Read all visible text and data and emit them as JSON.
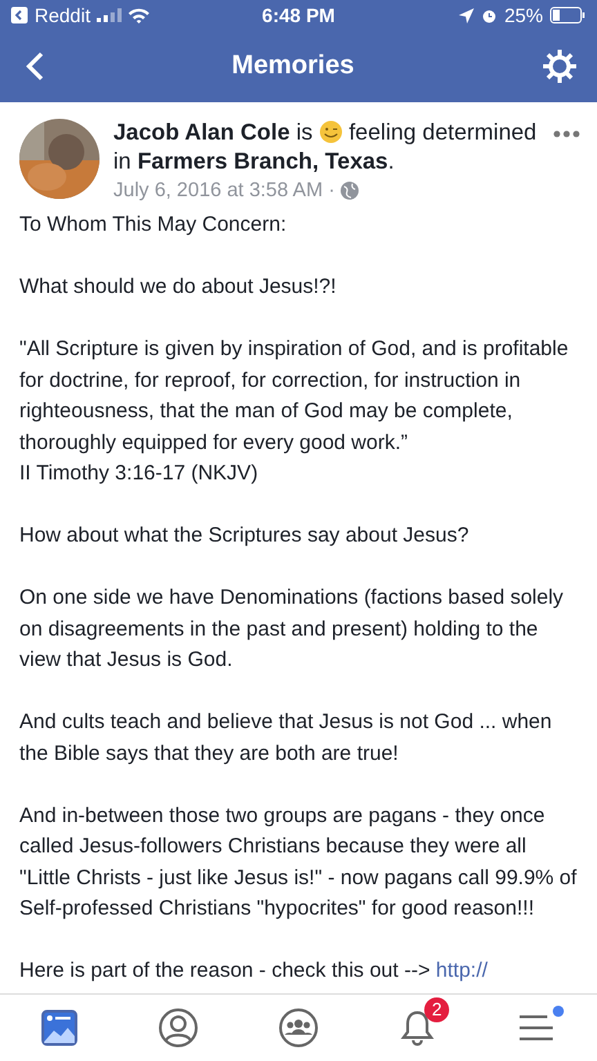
{
  "status_bar": {
    "back_app": "Reddit",
    "time": "6:48 PM",
    "battery": "25%"
  },
  "nav_bar": {
    "title": "Memories"
  },
  "post": {
    "author": "Jacob Alan Cole",
    "feeling_prefix": "is",
    "feeling": "feeling determined",
    "location_prefix": "in",
    "location": "Farmers Branch, Texas",
    "location_suffix": ".",
    "date": "July 6, 2016 at 3:58 AM ·",
    "paragraphs": [
      {
        "lines": [
          "To Whom This May Concern:"
        ]
      },
      {
        "lines": [
          "What should we do about Jesus!?!"
        ]
      },
      {
        "lines": [
          "\"All Scripture is given by inspiration of God, and is profitable for doctrine, for reproof, for correction, for instruction in righteousness, that the man of God may be complete, thoroughly equipped for every good work.”",
          "II Timothy 3:16-17 (NKJV)"
        ]
      },
      {
        "lines": [
          "How about what the Scriptures say about Jesus?"
        ]
      },
      {
        "lines": [
          "On one side we have Denominations (factions based solely on disagreements in the past and present) holding to the view that Jesus is God."
        ]
      },
      {
        "lines": [
          "And cults teach and believe that Jesus is not God ... when the Bible says that they are both are true!"
        ]
      },
      {
        "lines": [
          "And in-between those two groups are pagans - they once called Jesus-followers Christians because they were all \"Little Christs - just like Jesus is!\" - now pagans call 99.9% of Self-professed Christians \"hypocrites\" for good reason!!!"
        ]
      },
      {
        "lines": [
          "Here is part of the reason - check this out -->"
        ],
        "link": "http://"
      }
    ]
  },
  "tab_bar": [
    {
      "kind": "feed",
      "selected": true
    },
    {
      "kind": "profile",
      "selected": false
    },
    {
      "kind": "groups",
      "selected": false
    },
    {
      "kind": "notifications",
      "selected": false,
      "badge": "2"
    },
    {
      "kind": "menu",
      "selected": false,
      "dot": true
    }
  ]
}
